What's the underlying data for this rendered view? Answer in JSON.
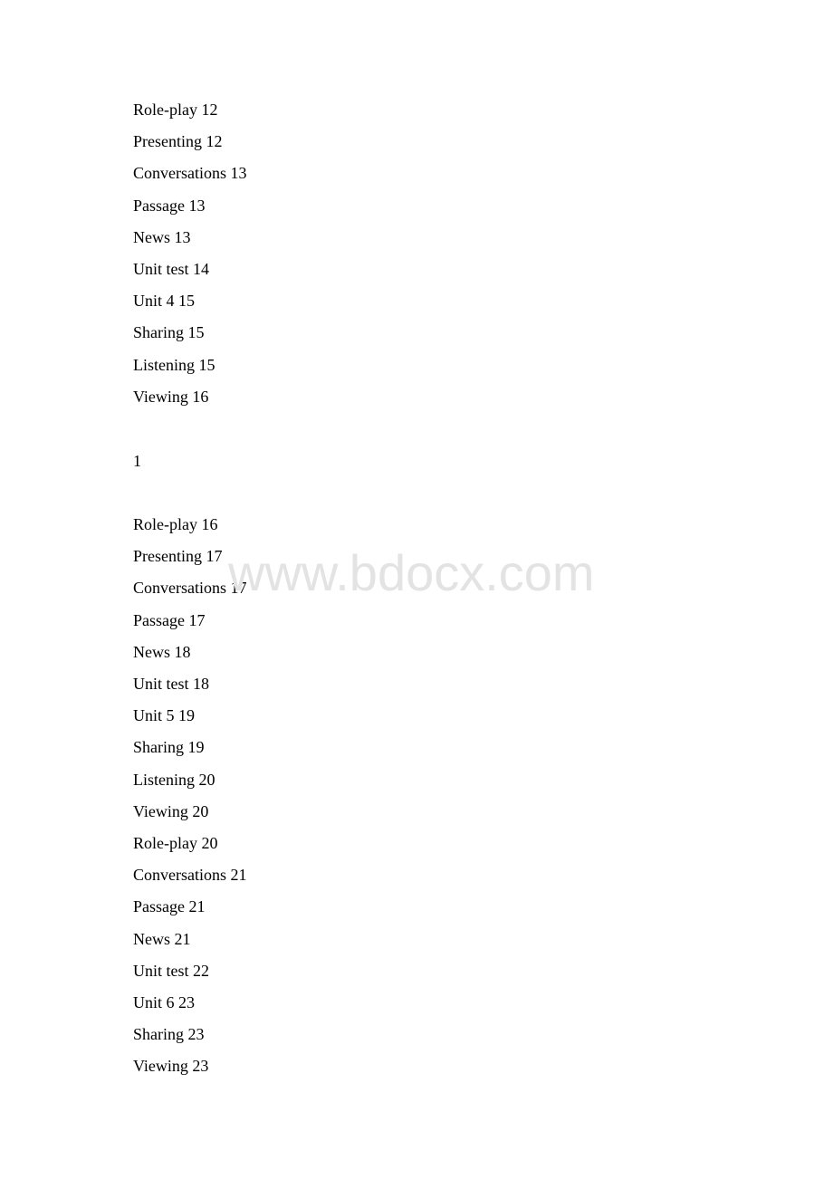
{
  "toc_group_1": [
    "Role-play 12",
    "Presenting 12",
    "Conversations 13",
    "Passage 13",
    "News 13",
    "Unit test 14",
    "Unit 4 15",
    "Sharing 15",
    "Listening 15",
    "Viewing 16"
  ],
  "page_number": "1",
  "toc_group_2": [
    "Role-play 16",
    "Presenting 17",
    "Conversations 17",
    "Passage 17",
    "News 18",
    "Unit test 18",
    "Unit 5 19",
    "Sharing 19",
    "Listening 20",
    "Viewing 20",
    "Role-play 20",
    "Conversations 21",
    "Passage 21",
    "News 21",
    "Unit test 22",
    "Unit 6 23",
    "Sharing 23",
    "Viewing 23"
  ],
  "watermark": "www.bdocx.com"
}
